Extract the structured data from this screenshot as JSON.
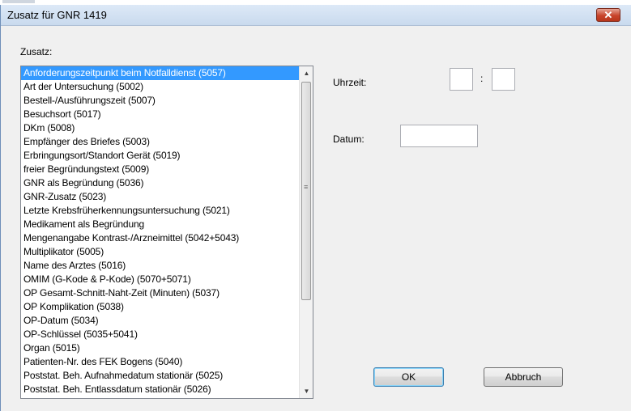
{
  "dialog": {
    "title": "Zusatz für GNR 1419"
  },
  "zusatz": {
    "label": "Zusatz:",
    "items": [
      "Anforderungszeitpunkt beim Notfalldienst (5057)",
      "Art der Untersuchung (5002)",
      "Bestell-/Ausführungszeit (5007)",
      "Besuchsort (5017)",
      "DKm (5008)",
      "Empfänger des Briefes (5003)",
      "Erbringungsort/Standort Gerät (5019)",
      "freier Begründungstext (5009)",
      "GNR als Begründung (5036)",
      "GNR-Zusatz (5023)",
      "Letzte Krebsfrüherkennungsuntersuchung (5021)",
      "Medikament als Begründung",
      "Mengenangabe Kontrast-/Arzneimittel (5042+5043)",
      "Multiplikator (5005)",
      "Name des Arztes (5016)",
      "OMIM (G-Kode & P-Kode) (5070+5071)",
      "OP Gesamt-Schnitt-Naht-Zeit (Minuten) (5037)",
      "OP Komplikation (5038)",
      "OP-Datum (5034)",
      "OP-Schlüssel (5035+5041)",
      "Organ (5015)",
      "Patienten-Nr. des FEK Bogens (5040)",
      "Poststat. Beh. Aufnahmedatum stationär (5025)",
      "Poststat. Beh. Entlassdatum stationär (5026)"
    ],
    "selected_index": 0
  },
  "uhrzeit": {
    "label": "Uhrzeit:",
    "separator": ":",
    "hours": "",
    "minutes": ""
  },
  "datum": {
    "label": "Datum:",
    "value": ""
  },
  "buttons": {
    "ok": "OK",
    "cancel": "Abbruch"
  },
  "titlebar_close": "x",
  "colors": {
    "selection": "#3399ff",
    "close": "#c8452c",
    "dialog_bg": "#f0f0f0"
  }
}
